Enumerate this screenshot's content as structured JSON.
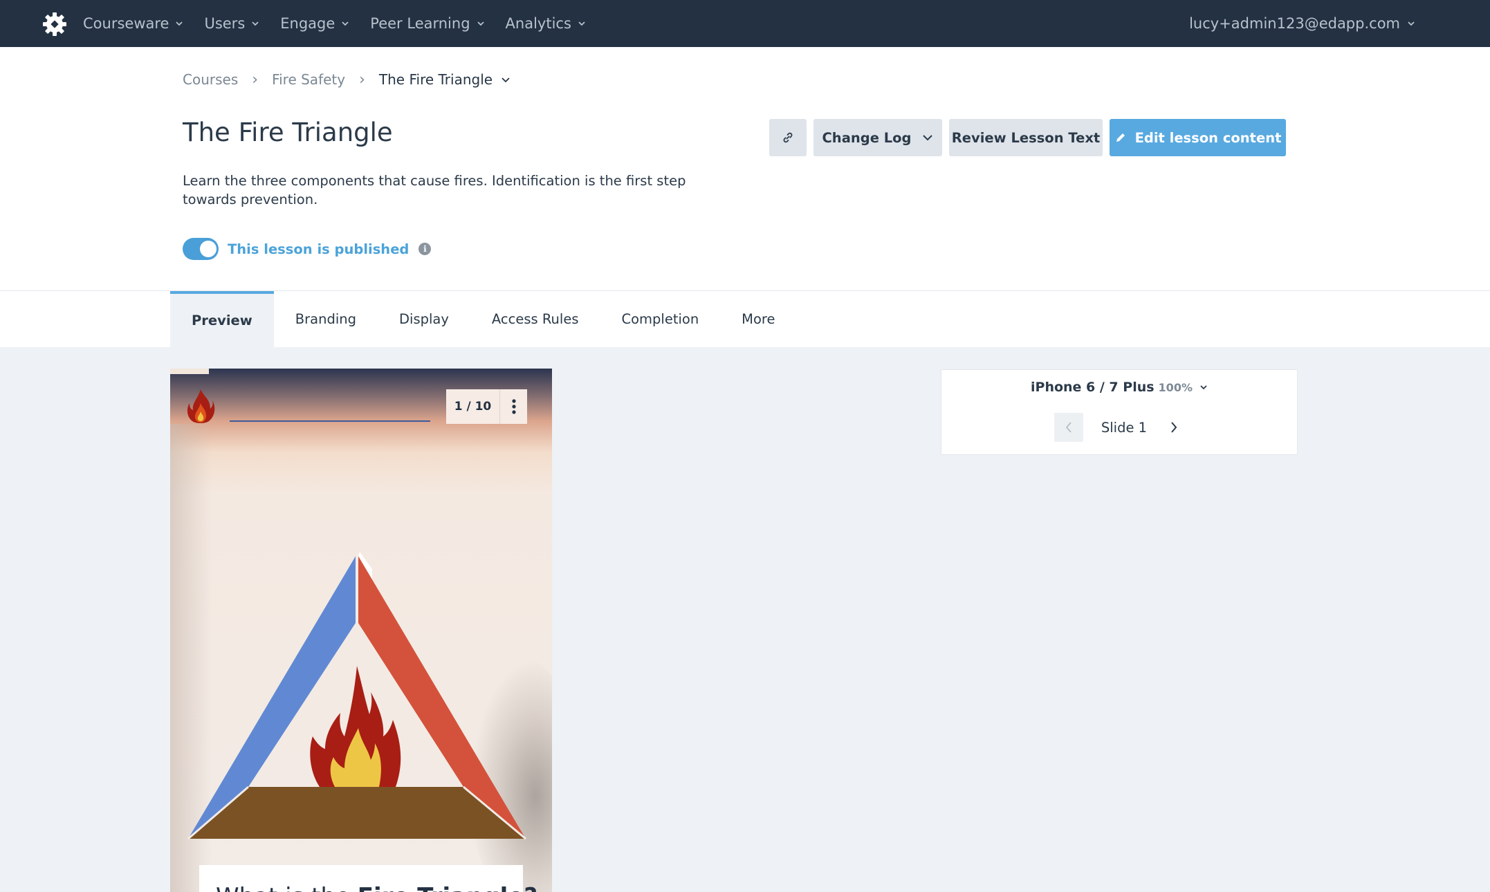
{
  "nav": {
    "items": [
      {
        "label": "Courseware"
      },
      {
        "label": "Users"
      },
      {
        "label": "Engage"
      },
      {
        "label": "Peer Learning"
      },
      {
        "label": "Analytics"
      }
    ],
    "user_email": "lucy+admin123@edapp.com"
  },
  "breadcrumb": {
    "items": [
      "Courses",
      "Fire Safety"
    ],
    "current": "The Fire Triangle"
  },
  "lesson": {
    "title": "The Fire Triangle",
    "description": "Learn the three components that cause fires. Identification is the first step towards prevention.",
    "published_label": "This lesson is published",
    "published": true
  },
  "actions": {
    "change_log": "Change Log",
    "review_text": "Review Lesson Text",
    "edit_content": "Edit lesson content"
  },
  "tabs": [
    {
      "label": "Preview",
      "active": true
    },
    {
      "label": "Branding",
      "active": false
    },
    {
      "label": "Display",
      "active": false
    },
    {
      "label": "Access Rules",
      "active": false
    },
    {
      "label": "Completion",
      "active": false
    },
    {
      "label": "More",
      "active": false
    }
  ],
  "preview": {
    "counter": "1 / 10",
    "question_prefix": "What is the ",
    "question_bold": "Fire Triangle?"
  },
  "device": {
    "name": "iPhone 6 / 7 Plus",
    "zoom": "100%",
    "slide_label": "Slide 1"
  },
  "colors": {
    "nav_bg": "#233142",
    "accent": "#58a9e0",
    "triangle_left": "#6189d3",
    "triangle_right": "#d4523b",
    "triangle_base": "#7b5224",
    "flame_outer": "#a81e14",
    "flame_inner": "#eec646"
  }
}
